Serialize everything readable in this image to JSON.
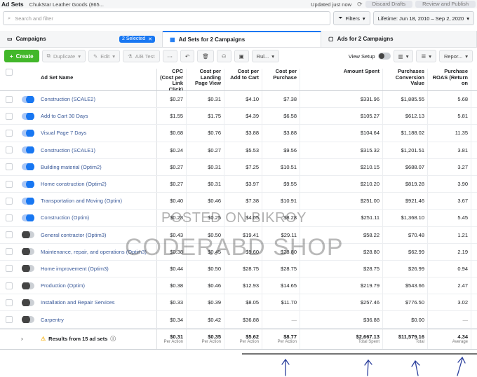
{
  "header": {
    "title": "Ad Sets",
    "account": "ChukStar Leather Goods (865...",
    "updated": "Updated just now",
    "discard": "Discard Drafts",
    "review": "Review and Publish"
  },
  "search": {
    "placeholder": "Search and filter"
  },
  "filters": {
    "label": "Filters",
    "lifetime": "Lifetime: Jun 18, 2010 – Sep 2, 2020"
  },
  "tabs": {
    "campaigns": "Campaigns",
    "selected": "2 Selected",
    "adsets": "Ad Sets for 2 Campaigns",
    "ads": "Ads for 2 Campaigns"
  },
  "toolbar": {
    "create": "Create",
    "duplicate": "Duplicate",
    "edit": "Edit",
    "abtest": "A/B Test",
    "rules": "Rul...",
    "viewsetup": "View Setup",
    "reports": "Repor..."
  },
  "columns": {
    "name": "Ad Set Name",
    "cpc": "CPC (Cost per Link Click)",
    "cplpv": "Cost per Landing Page View",
    "cpatc": "Cost per Add to Cart",
    "cpp": "Cost per Purchase",
    "spent": "Amount Spent",
    "pcv": "Purchases Conversion Value",
    "roas": "Purchase ROAS (Return on"
  },
  "rows": [
    {
      "name": "Construction (SCALE2)",
      "on": true,
      "cpc": "$0.27",
      "cplpv": "$0.31",
      "cpatc": "$4.10",
      "cpp": "$7.38",
      "spent": "$331.96",
      "pcv": "$1,885.55",
      "roas": "5.68"
    },
    {
      "name": "Add to Cart 30 Days",
      "on": true,
      "cpc": "$1.55",
      "cplpv": "$1.75",
      "cpatc": "$4.39",
      "cpp": "$6.58",
      "spent": "$105.27",
      "pcv": "$612.13",
      "roas": "5.81"
    },
    {
      "name": "Visual Page 7 Days",
      "on": true,
      "cpc": "$0.68",
      "cplpv": "$0.76",
      "cpatc": "$3.88",
      "cpp": "$3.88",
      "spent": "$104.64",
      "pcv": "$1,188.02",
      "roas": "11.35"
    },
    {
      "name": "Construction (SCALE1)",
      "on": true,
      "cpc": "$0.24",
      "cplpv": "$0.27",
      "cpatc": "$5.53",
      "cpp": "$9.56",
      "spent": "$315.32",
      "pcv": "$1,201.51",
      "roas": "3.81"
    },
    {
      "name": "Building material (Optim2)",
      "on": true,
      "cpc": "$0.27",
      "cplpv": "$0.31",
      "cpatc": "$7.25",
      "cpp": "$10.51",
      "spent": "$210.15",
      "pcv": "$688.07",
      "roas": "3.27"
    },
    {
      "name": "Home construction (Optim2)",
      "on": true,
      "cpc": "$0.27",
      "cplpv": "$0.31",
      "cpatc": "$3.97",
      "cpp": "$9.55",
      "spent": "$210.20",
      "pcv": "$819.28",
      "roas": "3.90"
    },
    {
      "name": "Transportation and Moving (Optim)",
      "on": true,
      "cpc": "$0.40",
      "cplpv": "$0.46",
      "cpatc": "$7.38",
      "cpp": "$10.91",
      "spent": "$251.00",
      "pcv": "$921.46",
      "roas": "3.67"
    },
    {
      "name": "Construction (Optim)",
      "on": true,
      "cpc": "$0.23",
      "cplpv": "$0.25",
      "cpatc": "$4.05",
      "cpp": "$8.28",
      "spent": "$251.11",
      "pcv": "$1,368.10",
      "roas": "5.45"
    },
    {
      "name": "General contractor (Optim3)",
      "on": false,
      "cpc": "$0.43",
      "cplpv": "$0.50",
      "cpatc": "$19.41",
      "cpp": "$29.11",
      "spent": "$58.22",
      "pcv": "$70.48",
      "roas": "1.21"
    },
    {
      "name": "Maintenance, repair, and operations (Optim3)",
      "on": false,
      "cpc": "$0.38",
      "cplpv": "$0.45",
      "cpatc": "$9.60",
      "cpp": "$28.80",
      "spent": "$28.80",
      "pcv": "$62.99",
      "roas": "2.19"
    },
    {
      "name": "Home improvement (Optim3)",
      "on": false,
      "cpc": "$0.44",
      "cplpv": "$0.50",
      "cpatc": "$28.75",
      "cpp": "$28.75",
      "spent": "$28.75",
      "pcv": "$26.99",
      "roas": "0.94"
    },
    {
      "name": "Production (Optim)",
      "on": false,
      "cpc": "$0.38",
      "cplpv": "$0.46",
      "cpatc": "$12.93",
      "cpp": "$14.65",
      "spent": "$219.79",
      "pcv": "$543.66",
      "roas": "2.47"
    },
    {
      "name": "Installation and Repair Services",
      "on": false,
      "cpc": "$0.33",
      "cplpv": "$0.39",
      "cpatc": "$8.05",
      "cpp": "$11.70",
      "spent": "$257.46",
      "pcv": "$776.50",
      "roas": "3.02"
    },
    {
      "name": "Carpentry",
      "on": false,
      "cpc": "$0.34",
      "cplpv": "$0.42",
      "cpatc": "$36.88",
      "cpp": "—",
      "spent": "$36.88",
      "pcv": "$0.00",
      "roas": "—"
    }
  ],
  "totals": {
    "label": "Results from 15 ad sets",
    "cpc": "$0.31",
    "cpc_l": "Per Action",
    "cplpv": "$0.35",
    "cplpv_l": "Per Action",
    "cpatc": "$5.62",
    "cpatc_l": "Per Action",
    "cpp": "$8.77",
    "cpp_l": "Per Action",
    "spent": "$2,667.13",
    "spent_l": "Total Spent",
    "pcv": "$11,579.16",
    "pcv_l": "Total",
    "roas": "4.34",
    "roas_l": "Average"
  },
  "watermark": {
    "line1": "POSTED ON BIKROY",
    "line2": "CODERABD SHOP"
  }
}
